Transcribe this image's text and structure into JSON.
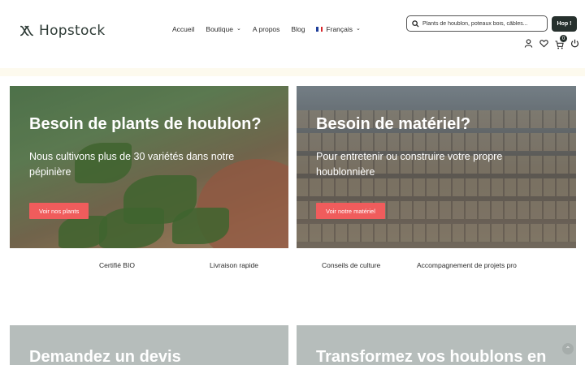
{
  "brand": {
    "name": "Hopstock"
  },
  "nav": {
    "items": [
      {
        "label": "Accueil",
        "dropdown": false
      },
      {
        "label": "Boutique",
        "dropdown": true
      },
      {
        "label": "A propos",
        "dropdown": false
      },
      {
        "label": "Blog",
        "dropdown": false
      }
    ],
    "language": {
      "label": "Français",
      "dropdown": true
    }
  },
  "search": {
    "placeholder": "Plants de houblon, poteaux bois, câbles...",
    "button_label": "Hop !"
  },
  "header_icons": {
    "items": [
      "user-icon",
      "heart-icon",
      "cart-icon",
      "power-icon"
    ],
    "cart_count": "0"
  },
  "hero": {
    "left": {
      "title": "Besoin de plants de houblon?",
      "subtitle": "Nous cultivons plus de 30 variétés dans notre pépinière",
      "button": "Voir nos plants"
    },
    "right": {
      "title": "Besoin de matériel?",
      "subtitle": "Pour entretenir ou construire votre propre houblonnière",
      "button": "Voir notre matériel"
    }
  },
  "features": [
    "Certifié BIO",
    "Livraison rapide",
    "Conseils de culture",
    "Accompagnement de projets pro"
  ],
  "lower": {
    "left_title": "Demandez un devis",
    "right_title": "Transformez vos houblons en"
  },
  "colors": {
    "accent": "#f05c5c",
    "dark": "#26302d",
    "card_gray": "#b6bdbb",
    "strip": "#fdfaee"
  }
}
